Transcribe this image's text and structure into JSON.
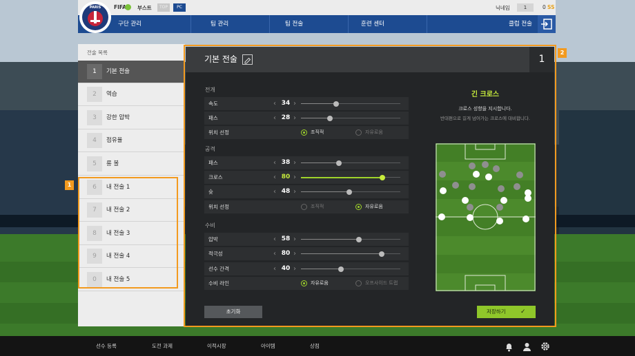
{
  "colors": {
    "brand": "#1d4b91",
    "accent": "#c7ec3c",
    "annotation": "#f39a1e",
    "save_button": "#8fc72a"
  },
  "header": {
    "club_crest_text": "PARIS",
    "brand_tag": "FIFA",
    "boost_label": "부스트",
    "top_badge": "TOP",
    "pc_badge": "PC",
    "nickname_label": "닉네임",
    "level_value": "1",
    "coin_value": "0",
    "coin_unit": "SS",
    "nav": [
      "구단 관리",
      "팀 관리",
      "팀 전술",
      "훈련 센터",
      "클럽 전술"
    ],
    "exit_icon": "exit-icon"
  },
  "sidebar": {
    "title": "전술 목록",
    "items": [
      {
        "num": "1",
        "label": "기본 전술",
        "active": true
      },
      {
        "num": "2",
        "label": "역습"
      },
      {
        "num": "3",
        "label": "강한 압박"
      },
      {
        "num": "4",
        "label": "점유율"
      },
      {
        "num": "5",
        "label": "롱 볼"
      },
      {
        "num": "6",
        "label": "내 전술 1"
      },
      {
        "num": "7",
        "label": "내 전술 2"
      },
      {
        "num": "8",
        "label": "내 전술 3"
      },
      {
        "num": "9",
        "label": "내 전술 4"
      },
      {
        "num": "0",
        "label": "내 전술 5"
      }
    ]
  },
  "annotations": {
    "tag1": "1",
    "tag2": "2"
  },
  "panel": {
    "title": "기본 전술",
    "edit_icon": "edit-icon",
    "slot_number": "1",
    "sections": {
      "buildup": {
        "title": "전개",
        "speed": {
          "label": "속도",
          "value": "34"
        },
        "passing": {
          "label": "패스",
          "value": "28"
        },
        "positioning": {
          "label": "위치 선정",
          "options": [
            "조직적",
            "자유로움"
          ],
          "selected": 0
        }
      },
      "attack": {
        "title": "공격",
        "passing": {
          "label": "패스",
          "value": "38"
        },
        "crossing": {
          "label": "크로스",
          "value": "80"
        },
        "shooting": {
          "label": "슛",
          "value": "48"
        },
        "positioning": {
          "label": "위치 선정",
          "options": [
            "조직적",
            "자유로움"
          ],
          "selected": 1
        }
      },
      "defence": {
        "title": "수비",
        "pressure": {
          "label": "압박",
          "value": "58"
        },
        "aggression": {
          "label": "적극성",
          "value": "80"
        },
        "width": {
          "label": "선수 간격",
          "value": "40"
        },
        "line": {
          "label": "수비 라인",
          "options": [
            "자유로움",
            "오프사이드 트랩"
          ],
          "selected": 0
        }
      }
    },
    "info": {
      "title": "긴 크로스",
      "desc1": "크로스 성향을 지시합니다.",
      "desc2": "반대편으로 길게 넘어가는 크로스에 대비합니다."
    },
    "reset_label": "초기화",
    "save_label": "저장하기",
    "save_icon": "check-icon"
  },
  "bottom_bar": {
    "items": [
      "선수 등록",
      "도전 과제",
      "이적시장",
      "아이템",
      "상점"
    ],
    "icons": [
      "bell-icon",
      "profile-icon",
      "gear-icon"
    ]
  }
}
